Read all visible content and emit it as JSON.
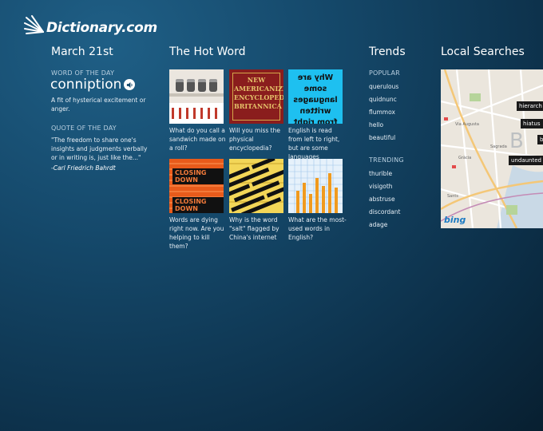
{
  "logo": {
    "text": "Dictionary.com"
  },
  "columns": {
    "date": "March 21st",
    "hot_word": "The Hot Word",
    "trends": "Trends",
    "local": "Local Searches"
  },
  "wotd": {
    "label": "WORD OF THE DAY",
    "word": "conniption",
    "definition": "A fit of hysterical excitement or anger."
  },
  "qotd": {
    "label": "QUOTE OF THE DAY",
    "text": "\"The freedom to share one's insights and judgments verbally or in writing is, just like the...\"",
    "author": "-Carl Friedrich Bahrdt"
  },
  "hot_word": {
    "tiles": [
      {
        "caption": "What do you call a sandwich made on a roll?"
      },
      {
        "caption": "Will you miss the physical encyclopedia?",
        "image_text": "NEW AMERICANIZED ENCYCLOPEDIA BRITANNICA"
      },
      {
        "caption": "English is read from left to right, but are some languages",
        "image_text": "Why are some languages written from right to left?"
      },
      {
        "caption": "Words are dying right now. Are you helping to kill them?",
        "image_text": "CLOSING DOWN"
      },
      {
        "caption": "Why is the word \"salt\" flagged by China's internet"
      },
      {
        "caption": "What are the most-used words in English?"
      }
    ]
  },
  "trends": {
    "popular_label": "POPULAR",
    "popular": [
      "querulous",
      "quidnunc",
      "flummox",
      "hello",
      "beautiful"
    ],
    "trending_label": "TRENDING",
    "trending": [
      "thurible",
      "visigoth",
      "abstruse",
      "discordant",
      "adage"
    ]
  },
  "local": {
    "tags": [
      "hierarch",
      "hiatus",
      "undaunted",
      "b"
    ],
    "map_brand": "bing"
  }
}
